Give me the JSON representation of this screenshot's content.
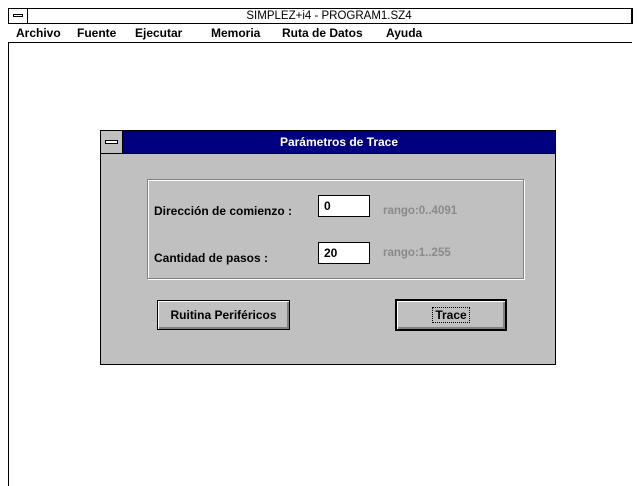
{
  "window": {
    "title": "SIMPLEZ+i4 - PROGRAM1.SZ4"
  },
  "menu": {
    "items": [
      {
        "label": "Archivo"
      },
      {
        "label": "Fuente"
      },
      {
        "label": "Ejecutar"
      },
      {
        "label": "Memoria"
      },
      {
        "label": "Ruta de Datos"
      },
      {
        "label": "Ayuda"
      }
    ]
  },
  "dialog": {
    "title": "Parámetros de Trace",
    "start_address_label": "Dirección de comienzo :",
    "start_address_value": "0",
    "start_address_range": "rango:0..4091",
    "steps_label": "Cantidad de pasos :",
    "steps_value": "20",
    "steps_range": "rango:1..255",
    "peripherals_button": "Ruitina Periféricos",
    "trace_button": "Trace"
  }
}
